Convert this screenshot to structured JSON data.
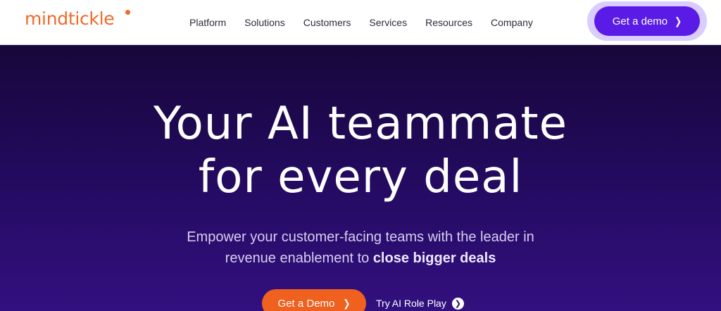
{
  "brand": {
    "name": "mindtickle",
    "color": "#f06a28"
  },
  "nav": {
    "items": [
      {
        "label": "Platform"
      },
      {
        "label": "Solutions"
      },
      {
        "label": "Customers"
      },
      {
        "label": "Services"
      },
      {
        "label": "Resources"
      },
      {
        "label": "Company"
      }
    ]
  },
  "header": {
    "demo_label": "Get a demo",
    "demo_icon": "chevron-right-icon",
    "accent": "#5b1be6"
  },
  "hero": {
    "headline_line1": "Your AI teammate",
    "headline_line2": "for every deal",
    "sub_line1": "Empower your customer-facing teams with the leader in",
    "sub_line2_plain": "revenue enablement to",
    "sub_line2_bold": "close bigger deals",
    "primary_cta": "Get a Demo",
    "primary_color": "#f0601f",
    "secondary_cta": "Try AI Role Play",
    "secondary_icon": "circle-chevron-right-icon"
  }
}
